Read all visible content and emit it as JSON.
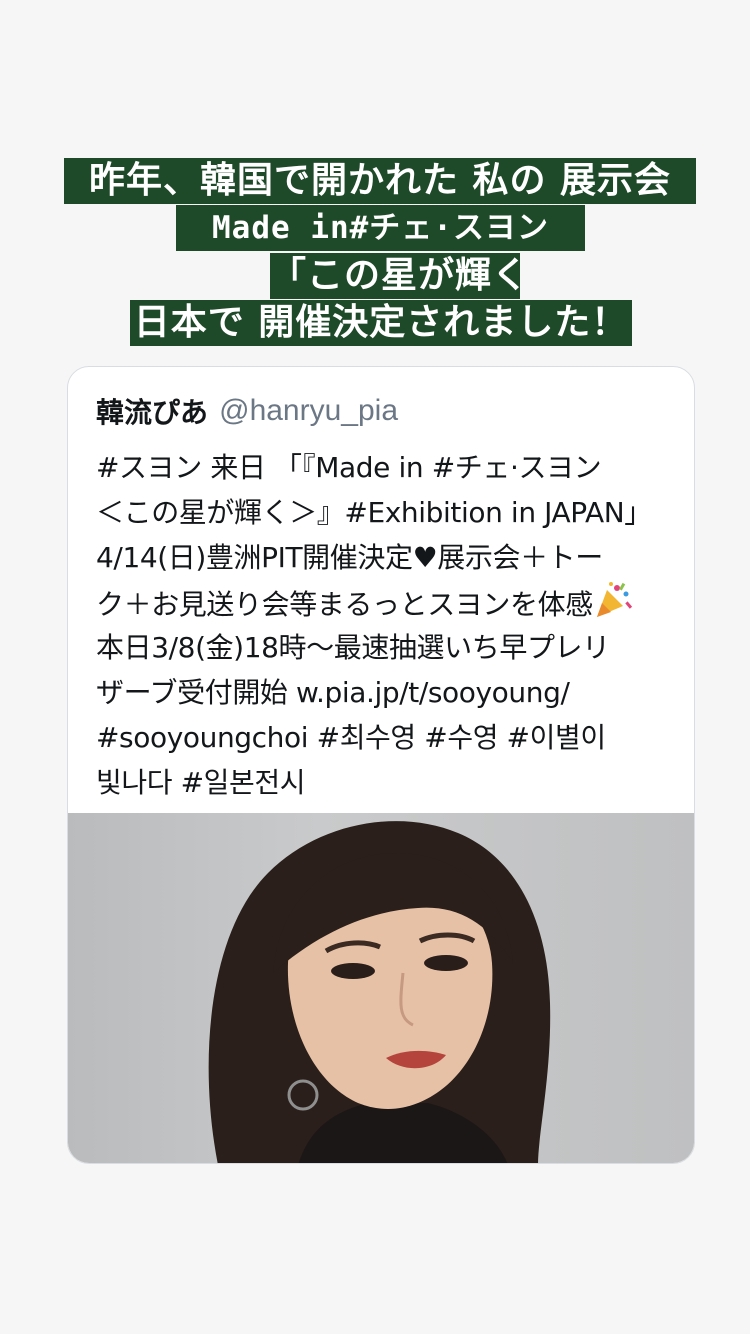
{
  "story_caption": {
    "lines": [
      "昨年、韓国で開かれた 私の 展示会",
      "Made in#チェ·スヨン",
      "「この星が輝く」",
      "日本で 開催決定されました！"
    ],
    "background_color": "#1f4a2a",
    "text_color": "#ffffff"
  },
  "tweet": {
    "author_name": "韓流ぴあ",
    "author_handle": "@hanryu_pia",
    "text_lines": [
      "#スヨン 来日 「『Made in #チェ·スヨン",
      "＜この星が輝く＞』#Exhibition in JAPAN」",
      "4/14(日)豊洲PIT開催決定♥展示会＋トー",
      "ク＋お見送り会等まるっとスヨンを体感",
      "本日3/8(金)18時～最速抽選いち早プレリ",
      "ザーブ受付開始 w.pia.jp/t/sooyoung/",
      "#sooyoungchoi #최수영 #수영 #이별이",
      "빛나다 #일본전시"
    ],
    "emoji": "party-popper-icon",
    "image": "portrait-photo"
  }
}
